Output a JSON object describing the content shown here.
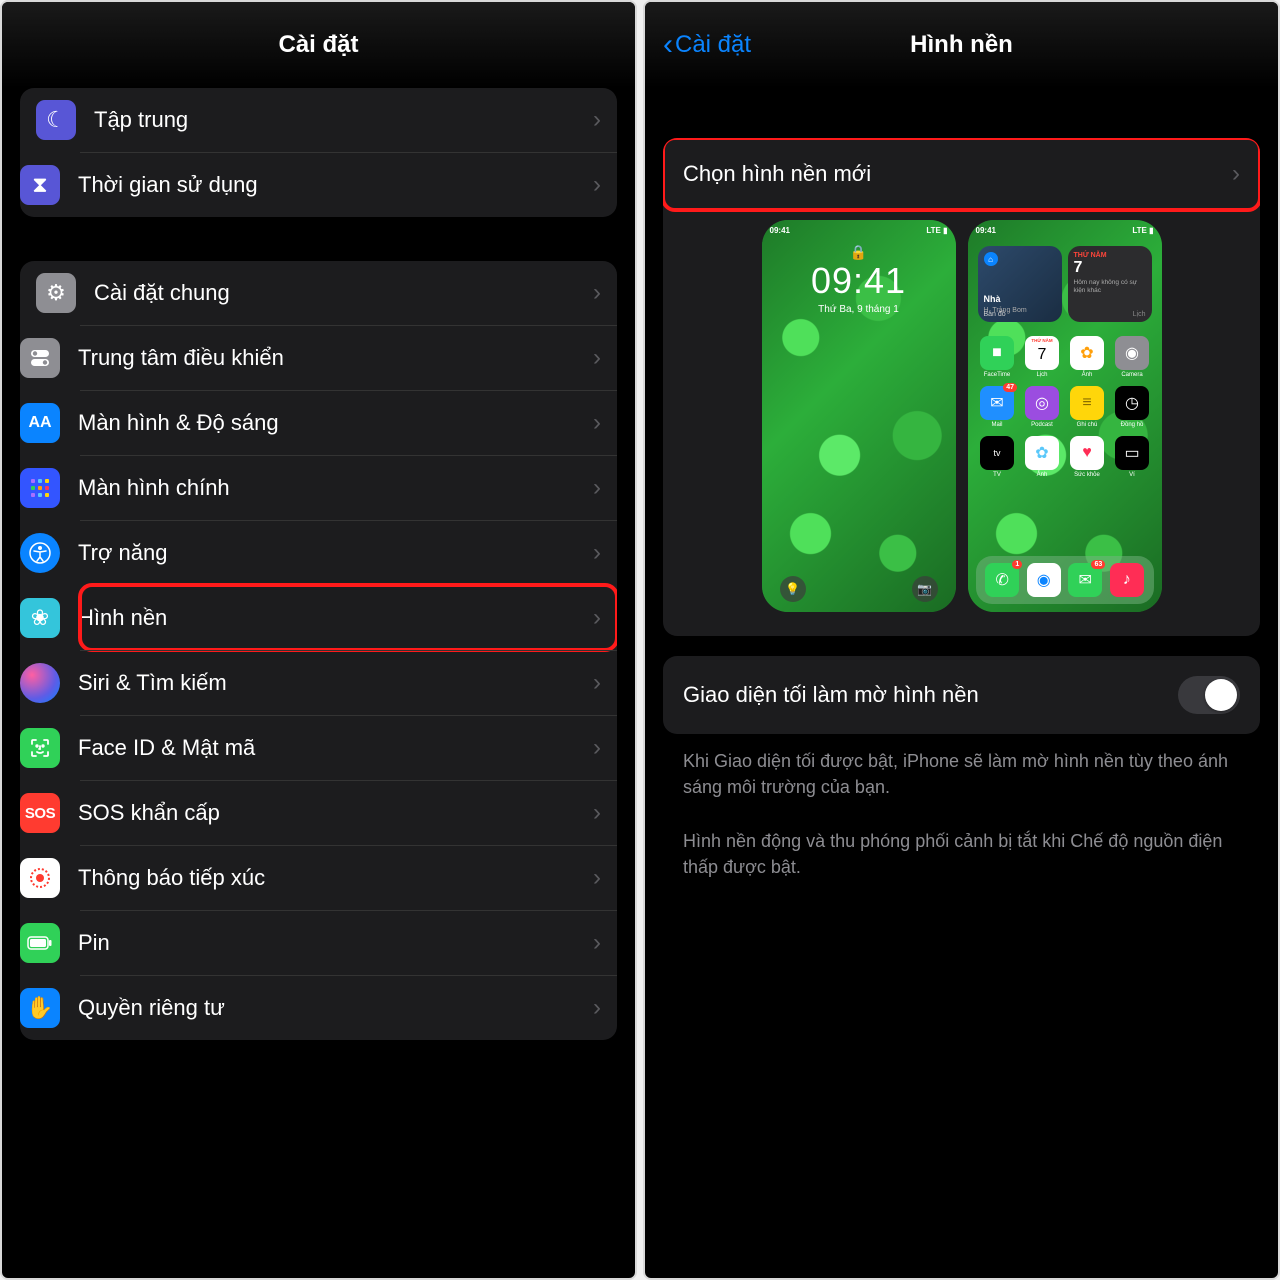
{
  "left": {
    "title": "Cài đặt",
    "group1": [
      {
        "label": "Tập trung"
      },
      {
        "label": "Thời gian sử dụng"
      }
    ],
    "group2": [
      {
        "label": "Cài đặt chung"
      },
      {
        "label": "Trung tâm điều khiển"
      },
      {
        "label": "Màn hình & Độ sáng"
      },
      {
        "label": "Màn hình chính"
      },
      {
        "label": "Trợ năng"
      },
      {
        "label": "Hình nền"
      },
      {
        "label": "Siri & Tìm kiếm"
      },
      {
        "label": "Face ID & Mật mã"
      },
      {
        "label": "SOS khẩn cấp"
      },
      {
        "label": "Thông báo tiếp xúc"
      },
      {
        "label": "Pin"
      },
      {
        "label": "Quyền riêng tư"
      }
    ],
    "sos": "SOS",
    "aa": "AA",
    "highlightIndex": 5
  },
  "right": {
    "back": "Cài đặt",
    "title": "Hình nền",
    "choose": "Chọn hình nền mới",
    "darkToggle": "Giao diện tối làm mờ hình nền",
    "footer1": "Khi Giao diện tối được bật, iPhone sẽ làm mờ hình nền tùy theo ánh sáng môi trường của bạn.",
    "footer2": "Hình nền động và thu phóng phối cảnh bị tắt khi Chế độ nguồn điện thấp được bật.",
    "lock": {
      "status": "09:41",
      "time": "09:41",
      "date": "Thứ Ba, 9 tháng 1"
    },
    "home": {
      "widgets": {
        "map": {
          "title": "Nhà",
          "sub": "H. Trảng Bom",
          "foot": "Bản đồ"
        },
        "cal": {
          "day": "THỨ NĂM",
          "num": "7",
          "sub": "Hôm nay không có sự kiện khác",
          "foot": "Lịch"
        }
      },
      "apps": [
        {
          "name": "FaceTime",
          "color": "#30d158",
          "glyph": "■"
        },
        {
          "name": "Lịch",
          "color": "#ffffff",
          "glyph": "7",
          "txt": "#ff3b30",
          "top": "THỨ NĂM"
        },
        {
          "name": "Ảnh",
          "color": "#ffffff",
          "glyph": "✿",
          "txt": "#ff9f0a"
        },
        {
          "name": "Camera",
          "color": "#8e8e93",
          "glyph": "◉"
        },
        {
          "name": "Mail",
          "color": "#1f8fff",
          "glyph": "✉",
          "badge": "47"
        },
        {
          "name": "Podcast",
          "color": "#9b4de0",
          "glyph": "◎"
        },
        {
          "name": "Ghi chú",
          "color": "#ffd60a",
          "glyph": "≡",
          "txt": "#8a6d00"
        },
        {
          "name": "Đồng hồ",
          "color": "#000000",
          "glyph": "◷"
        },
        {
          "name": "TV",
          "color": "#000000",
          "glyph": "tv",
          "fs": "9"
        },
        {
          "name": "Ảnh",
          "color": "#ffffff",
          "glyph": "✿",
          "txt": "#5ac8fa"
        },
        {
          "name": "Sức khỏe",
          "color": "#ffffff",
          "glyph": "♥",
          "txt": "#ff2d55"
        },
        {
          "name": "Ví",
          "color": "#000000",
          "glyph": "▭"
        }
      ],
      "dock": [
        {
          "color": "#30d158",
          "glyph": "✆",
          "badge": "1"
        },
        {
          "color": "#ffffff",
          "glyph": "◉",
          "txt": "#0a84ff"
        },
        {
          "color": "#30d158",
          "glyph": "✉",
          "badge": "63"
        },
        {
          "color": "#ff2d55",
          "glyph": "♪"
        }
      ]
    }
  }
}
